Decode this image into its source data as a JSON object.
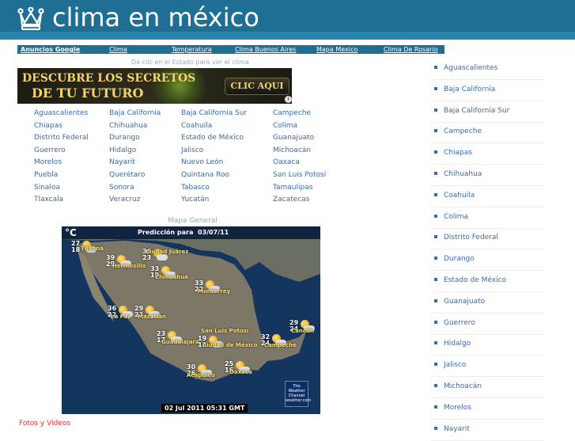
{
  "header": {
    "title": "clima en méxico",
    "logo_icon": "crown-icon"
  },
  "adbar": {
    "ads_label": "Anuncios Google",
    "links": [
      "Clima",
      "Temperatura",
      "Clima Buenos Aires",
      "Mapa Mexico",
      "Clima De Rosario"
    ]
  },
  "hint": "Da clic en el Estado para ver el clima",
  "banner": {
    "line1": "DESCUBRE LOS SECRETOS",
    "line2": "DE TU FUTURO",
    "cta": "CLIC AQUI"
  },
  "states": [
    [
      "Aguascalientes",
      "Baja California",
      "Baja California Sur",
      "Campeche"
    ],
    [
      "Chiapas",
      "Chihuahua",
      "Coahuila",
      "Colima"
    ],
    [
      "Distrito Federal",
      "Durango",
      "Estado de México",
      "Guanajuato"
    ],
    [
      "Guerrero",
      "Hidalgo",
      "Jalisco",
      "Michoacán"
    ],
    [
      "Morelos",
      "Nayarit",
      "Nuevo León",
      "Oaxaca"
    ],
    [
      "Puebla",
      "Querétaro",
      "Quintana Roo",
      "San Luis Potosí"
    ],
    [
      "Sinaloa",
      "Sonora",
      "Tabasco",
      "Tamaulipas"
    ],
    [
      "Tlaxcala",
      "Veracruz",
      "Yucatán",
      "Zacatecas"
    ]
  ],
  "mapa_label": "Mapa General",
  "map": {
    "unit": "°C",
    "prediction_label": "Predicción para",
    "prediction_date": "03/07/11",
    "footer_date": "02 Jul 2011 05:31 GMT",
    "brand": [
      "The",
      "Weather",
      "Channel",
      "weather.com"
    ],
    "cities": [
      {
        "name": "Tijuana",
        "high": "27",
        "low": "18"
      },
      {
        "name": "Ciudad Juárez",
        "high": "36",
        "low": "23"
      },
      {
        "name": "Hermosillo",
        "high": "39",
        "low": "29"
      },
      {
        "name": "Chihuahua",
        "high": "33",
        "low": "19"
      },
      {
        "name": "Monterrey",
        "high": "33",
        "low": "22"
      },
      {
        "name": "La Paz",
        "high": "36",
        "low": "22"
      },
      {
        "name": "Mazatlán",
        "high": "29",
        "low": "23"
      },
      {
        "name": "San Luis Potosí",
        "high": "",
        "low": ""
      },
      {
        "name": "Guadalajara",
        "high": "23",
        "low": "17"
      },
      {
        "name": "Ciudad de México",
        "high": "19",
        "low": "13"
      },
      {
        "name": "Campeche",
        "high": "32",
        "low": "24"
      },
      {
        "name": "Cancún",
        "high": "29",
        "low": "24"
      },
      {
        "name": "Acapulco",
        "high": "30",
        "low": "26"
      },
      {
        "name": "Oaxaca",
        "high": "25",
        "low": "16"
      }
    ]
  },
  "fotos": "Fotos y Videos",
  "sidebar": [
    "Aguascalientes",
    "Baja California",
    "Baja California Sur",
    "Campeche",
    "Chiapas",
    "Chihuahua",
    "Coahuila",
    "Colima",
    "Distrito Federal",
    "Durango",
    "Estado de México",
    "Guanajuato",
    "Guerrero",
    "Hidalgo",
    "Jalisco",
    "Michoacán",
    "Morelos",
    "Nayarit"
  ],
  "colors": {
    "header": "#1f6f95",
    "link": "#3e6aa3",
    "accent_red": "#e0312f"
  }
}
